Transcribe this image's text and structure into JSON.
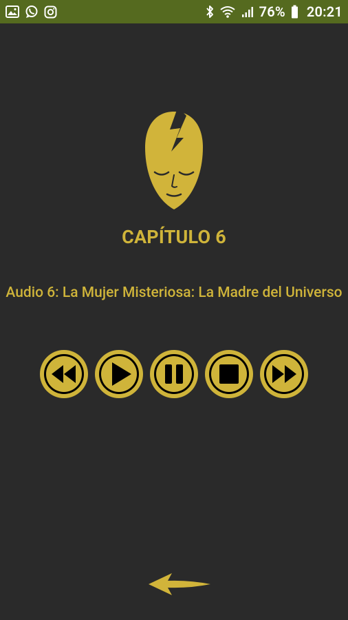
{
  "status_bar": {
    "battery_percent": "76%",
    "time": "20:21",
    "left_icons": [
      "image-icon",
      "whatsapp-icon",
      "instagram-icon"
    ],
    "right_icons": [
      "bluetooth-icon",
      "wifi-icon",
      "signal-icon",
      "battery-icon"
    ]
  },
  "player": {
    "chapter_title": "CAPÍTULO 6",
    "audio_title": "Audio 6: La Mujer Misteriosa: La Madre del Universo",
    "controls": [
      "rewind",
      "play",
      "pause",
      "stop",
      "fast-forward"
    ]
  },
  "colors": {
    "accent": "#cfb43a",
    "background": "#2a2a2a",
    "status_bar": "#556a1f"
  }
}
